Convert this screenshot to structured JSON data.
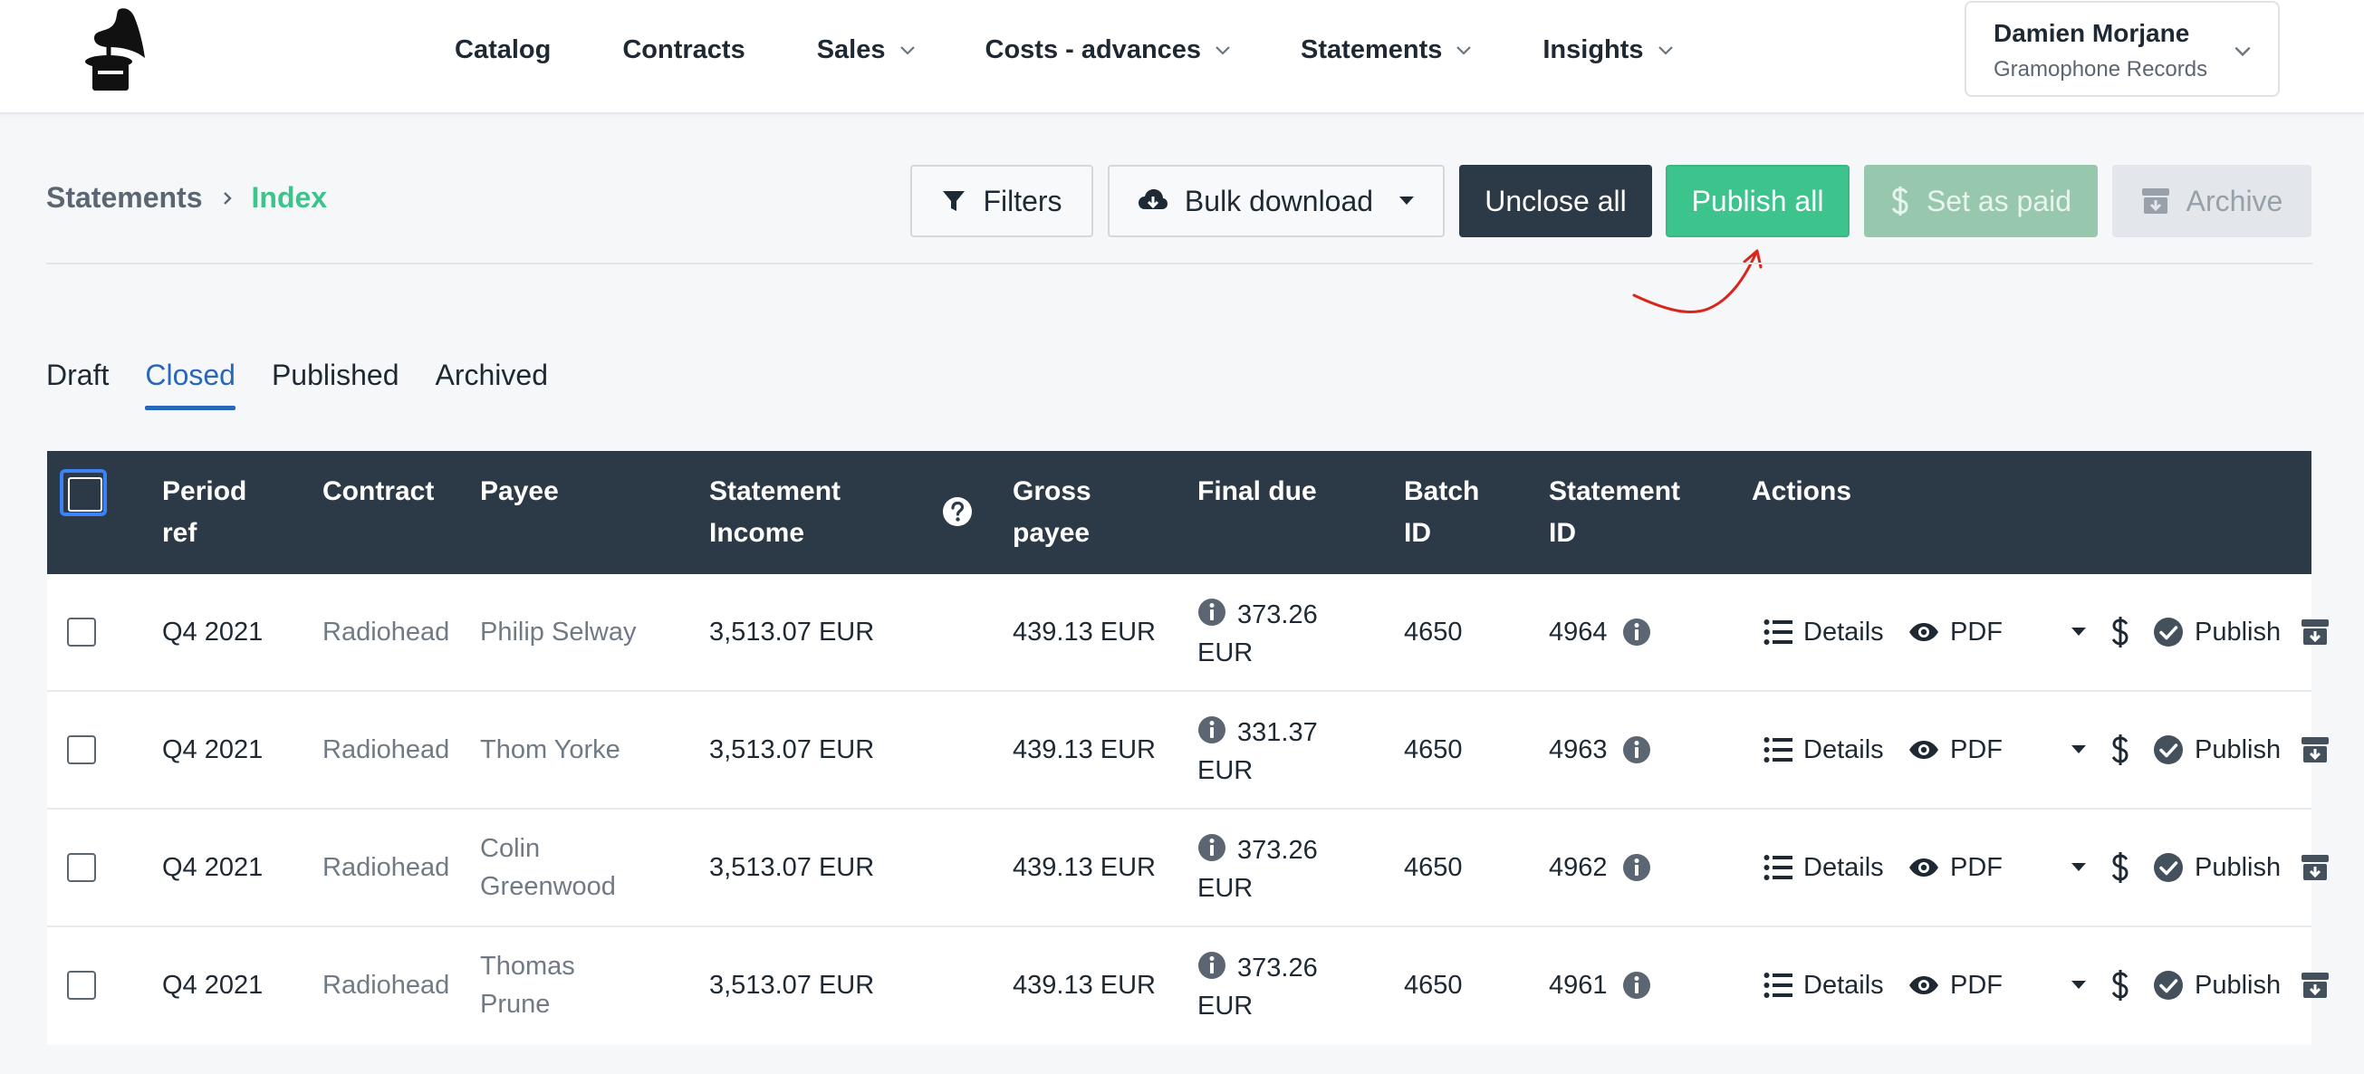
{
  "nav": {
    "items": [
      {
        "label": "Catalog",
        "dropdown": false
      },
      {
        "label": "Contracts",
        "dropdown": false
      },
      {
        "label": "Sales",
        "dropdown": true
      },
      {
        "label": "Costs - advances",
        "dropdown": true
      },
      {
        "label": "Statements",
        "dropdown": true
      },
      {
        "label": "Insights",
        "dropdown": true
      }
    ]
  },
  "user": {
    "name": "Damien Morjane",
    "org": "Gramophone Records"
  },
  "breadcrumb": {
    "root": "Statements",
    "current": "Index"
  },
  "toolbar": {
    "filters": "Filters",
    "bulk_download": "Bulk download",
    "unclose_all": "Unclose all",
    "publish_all": "Publish all",
    "set_as_paid": "Set as paid",
    "archive": "Archive"
  },
  "tabs": [
    {
      "label": "Draft",
      "active": false
    },
    {
      "label": "Closed",
      "active": true
    },
    {
      "label": "Published",
      "active": false
    },
    {
      "label": "Archived",
      "active": false
    }
  ],
  "table": {
    "headers": {
      "period": "Period ref",
      "contract": "Contract",
      "payee": "Payee",
      "income": "Statement Income",
      "gross": "Gross payee",
      "final": "Final due",
      "batch": "Batch ID",
      "statement": "Statement ID",
      "actions": "Actions"
    },
    "action_labels": {
      "details": "Details",
      "pdf": "PDF",
      "publish": "Publish"
    },
    "rows": [
      {
        "period": "Q4 2021",
        "contract": "Radiohead",
        "payee": "Philip Selway",
        "income": "3,513.07 EUR",
        "gross": "439.13 EUR",
        "final_amount": "373.26",
        "final_currency": "EUR",
        "batch": "4650",
        "statement": "4964"
      },
      {
        "period": "Q4 2021",
        "contract": "Radiohead",
        "payee": "Thom Yorke",
        "income": "3,513.07 EUR",
        "gross": "439.13 EUR",
        "final_amount": "331.37",
        "final_currency": "EUR",
        "batch": "4650",
        "statement": "4963"
      },
      {
        "period": "Q4 2021",
        "contract": "Radiohead",
        "payee": "Colin Greenwood",
        "income": "3,513.07 EUR",
        "gross": "439.13 EUR",
        "final_amount": "373.26",
        "final_currency": "EUR",
        "batch": "4650",
        "statement": "4962"
      },
      {
        "period": "Q4 2021",
        "contract": "Radiohead",
        "payee": "Thomas Prune",
        "income": "3,513.07 EUR",
        "gross": "439.13 EUR",
        "final_amount": "373.26",
        "final_currency": "EUR",
        "batch": "4650",
        "statement": "4961"
      }
    ]
  },
  "colors": {
    "accent_green": "#3cc48c",
    "header_dark": "#2c3a47",
    "tab_active": "#2968b8",
    "annotation_arrow": "#d9261c"
  }
}
